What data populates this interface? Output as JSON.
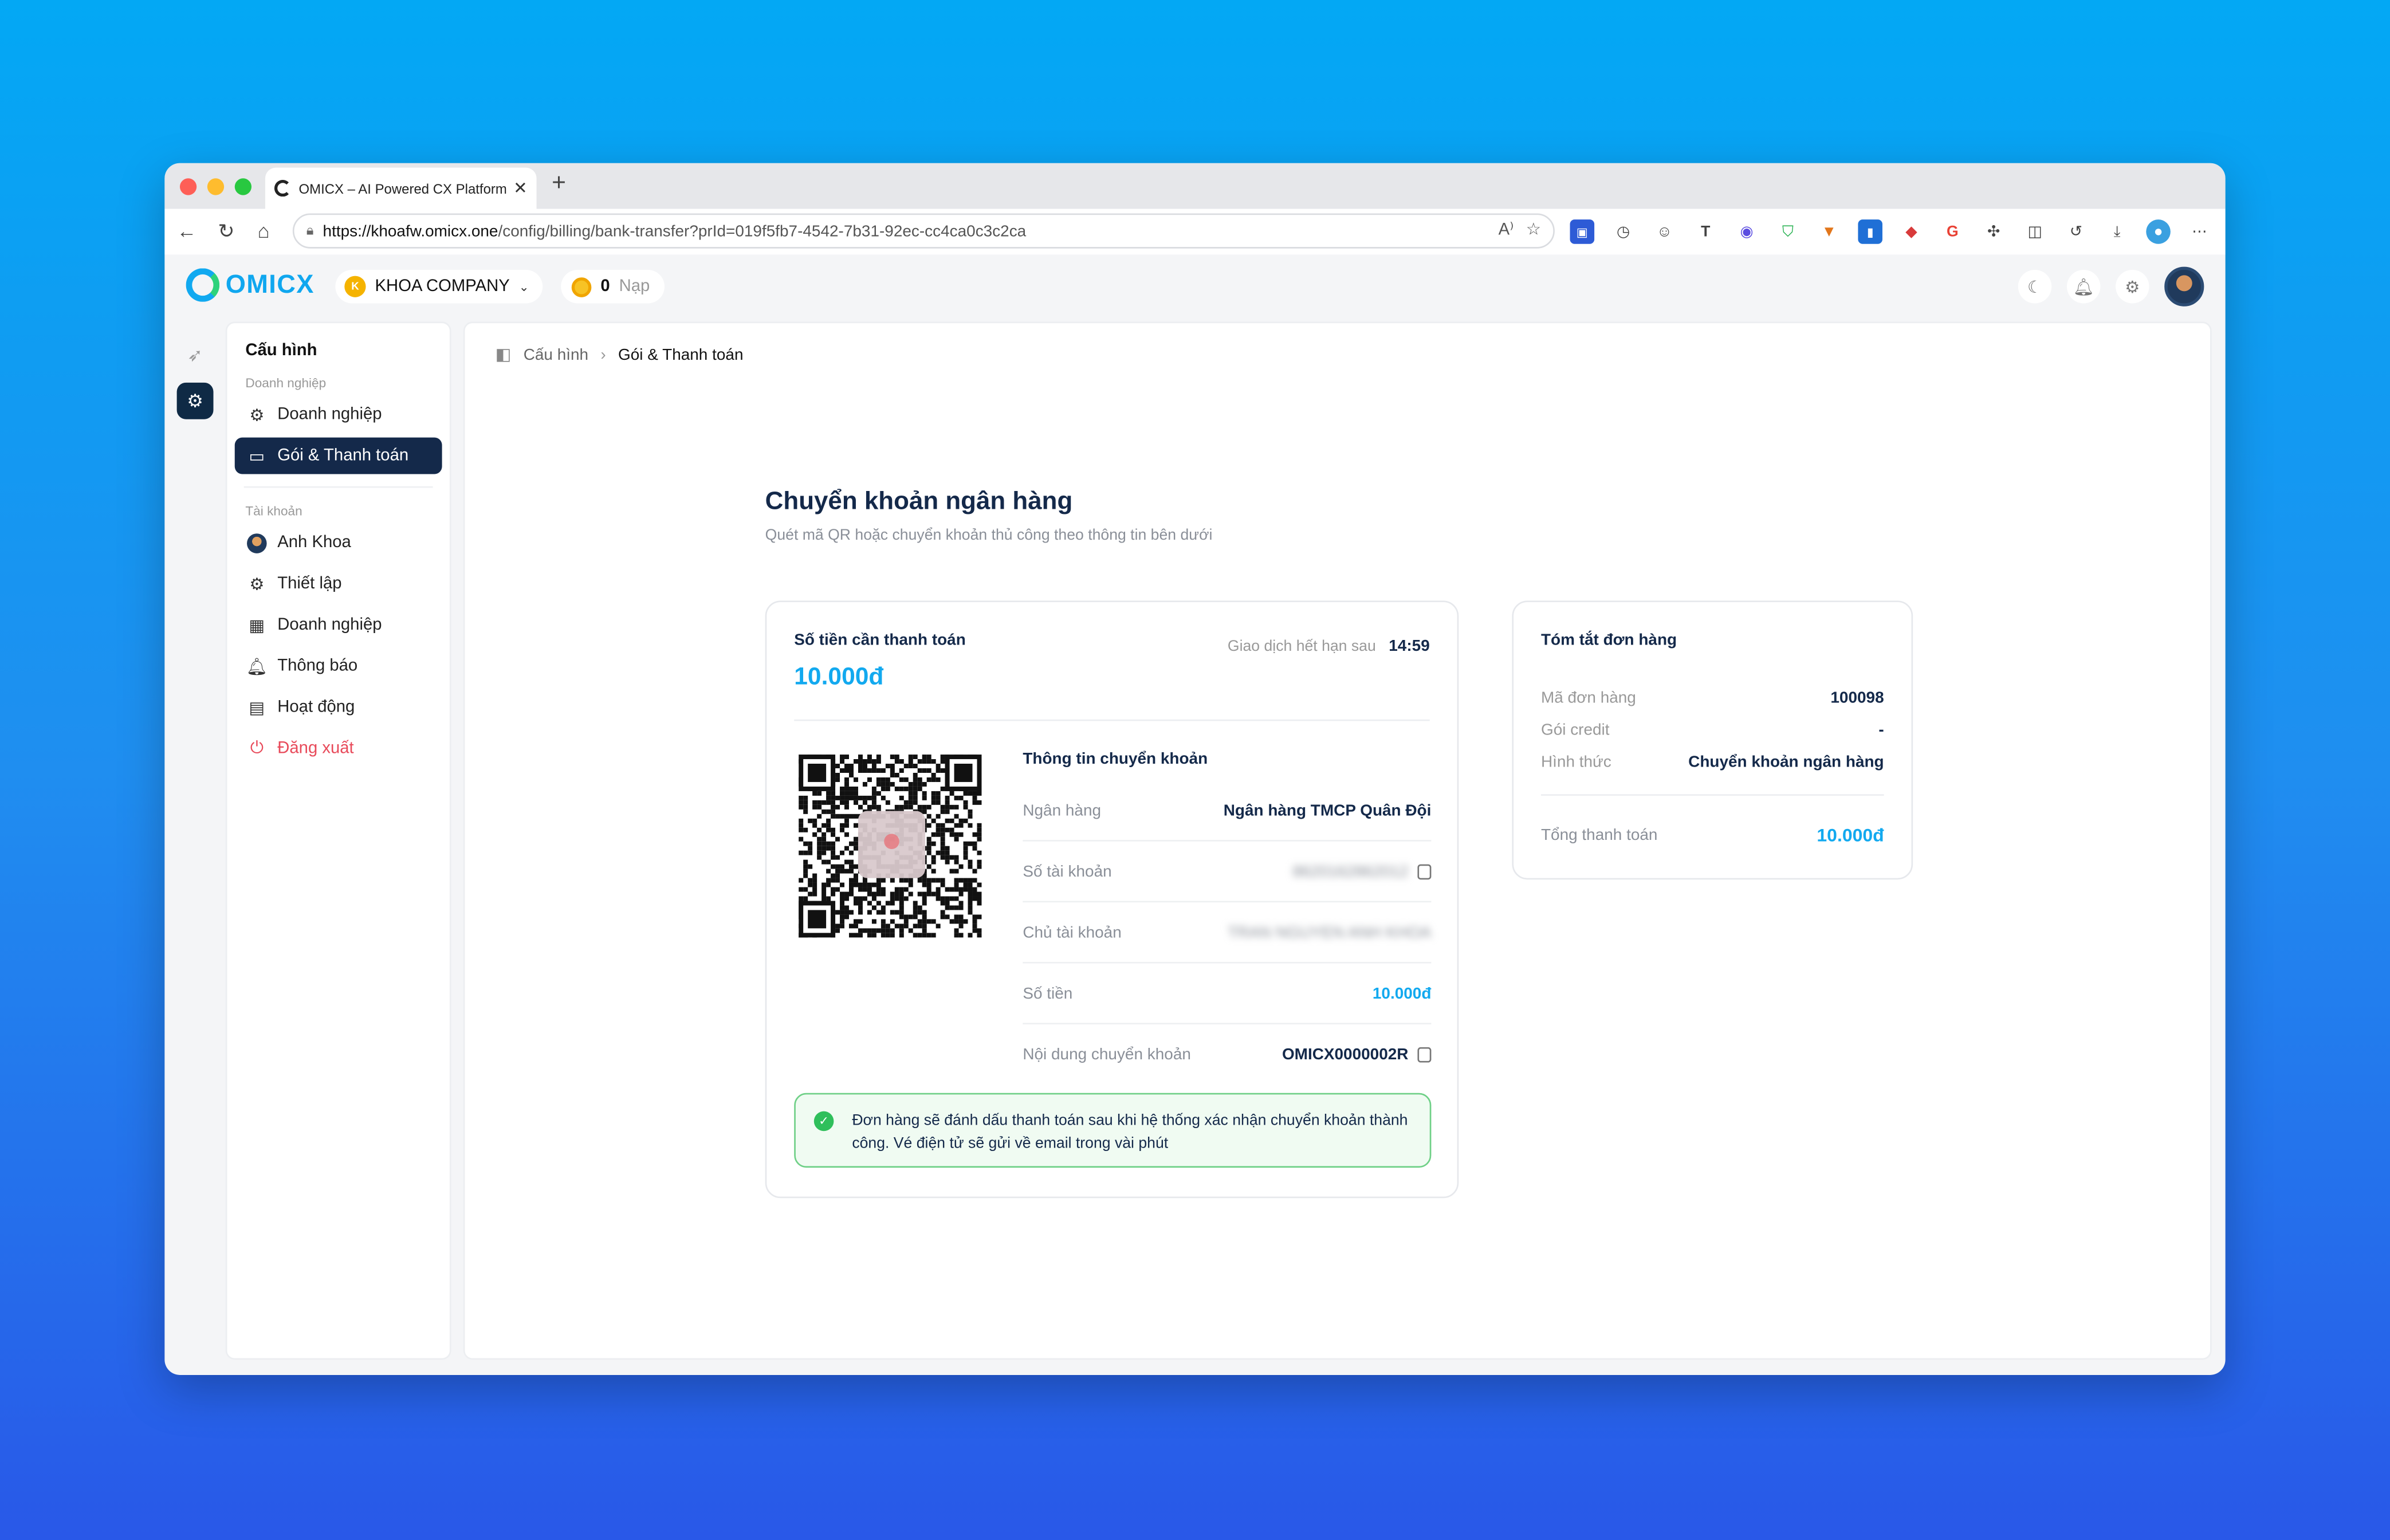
{
  "browser": {
    "tab_title": "OMICX – AI Powered CX Platform",
    "url_host": "https://khoafw.omicx.one",
    "url_path": "/config/billing/bank-transfer?prId=019f5fb7-4542-7b31-92ec-cc4ca0c3c2ca"
  },
  "header": {
    "logo_text": "OMICX",
    "company_badge": "K",
    "company_name": "KHOA COMPANY",
    "credit_value": "0",
    "credit_action": "Nạp"
  },
  "sidebar": {
    "title": "Cấu hình",
    "section_business": "Doanh nghiệp",
    "business_items": [
      {
        "label": "Doanh nghiệp",
        "icon": "gear-icon"
      },
      {
        "label": "Gói & Thanh toán",
        "icon": "card-icon"
      }
    ],
    "section_account": "Tài khoản",
    "account_items": [
      {
        "label": "Anh Khoa",
        "icon": "avatar"
      },
      {
        "label": "Thiết lập",
        "icon": "gear-icon"
      },
      {
        "label": "Doanh nghiệp",
        "icon": "building-icon"
      },
      {
        "label": "Thông báo",
        "icon": "bell-icon"
      },
      {
        "label": "Hoạt động",
        "icon": "activity-icon"
      },
      {
        "label": "Đăng xuất",
        "icon": "logout-icon"
      }
    ]
  },
  "breadcrumb": {
    "root": "Cấu hình",
    "current": "Gói & Thanh toán"
  },
  "page": {
    "title": "Chuyển khoản ngân hàng",
    "subtitle": "Quét mã QR hoặc chuyển khoản thủ công theo thông tin bên dưới"
  },
  "payment": {
    "amount_label": "Số tiền cần thanh toán",
    "amount": "10.000đ",
    "expiry_label": "Giao dịch hết hạn sau",
    "expiry_time": "14:59",
    "info_title": "Thông tin chuyển khoản",
    "rows": [
      {
        "key": "Ngân hàng",
        "value": "Ngân hàng TMCP Quân Đội"
      },
      {
        "key": "Số tài khoản",
        "value": "8620162862012"
      },
      {
        "key": "Chủ tài khoản",
        "value": "TRAN NGUYEN ANH KHOA"
      },
      {
        "key": "Số tiền",
        "value": "10.000đ"
      },
      {
        "key": "Nội dung chuyển khoản",
        "value": "OMICX0000002R"
      }
    ],
    "notice": "Đơn hàng sẽ đánh dấu thanh toán sau khi hệ thống xác nhận chuyển khoản thành công. Vé điện tử sẽ gửi về email trong vài phút"
  },
  "summary": {
    "title": "Tóm tắt đơn hàng",
    "rows": [
      {
        "key": "Mã đơn hàng",
        "value": "100098"
      },
      {
        "key": "Gói credit",
        "value": "-"
      },
      {
        "key": "Hình thức",
        "value": "Chuyển khoản ngân hàng"
      }
    ],
    "total_label": "Tổng thanh toán",
    "total_value": "10.000đ"
  },
  "colors": {
    "accent": "#12a9ef",
    "sidebar_active": "#14294a",
    "success": "#2fbf5b",
    "danger": "#e84a5a"
  }
}
